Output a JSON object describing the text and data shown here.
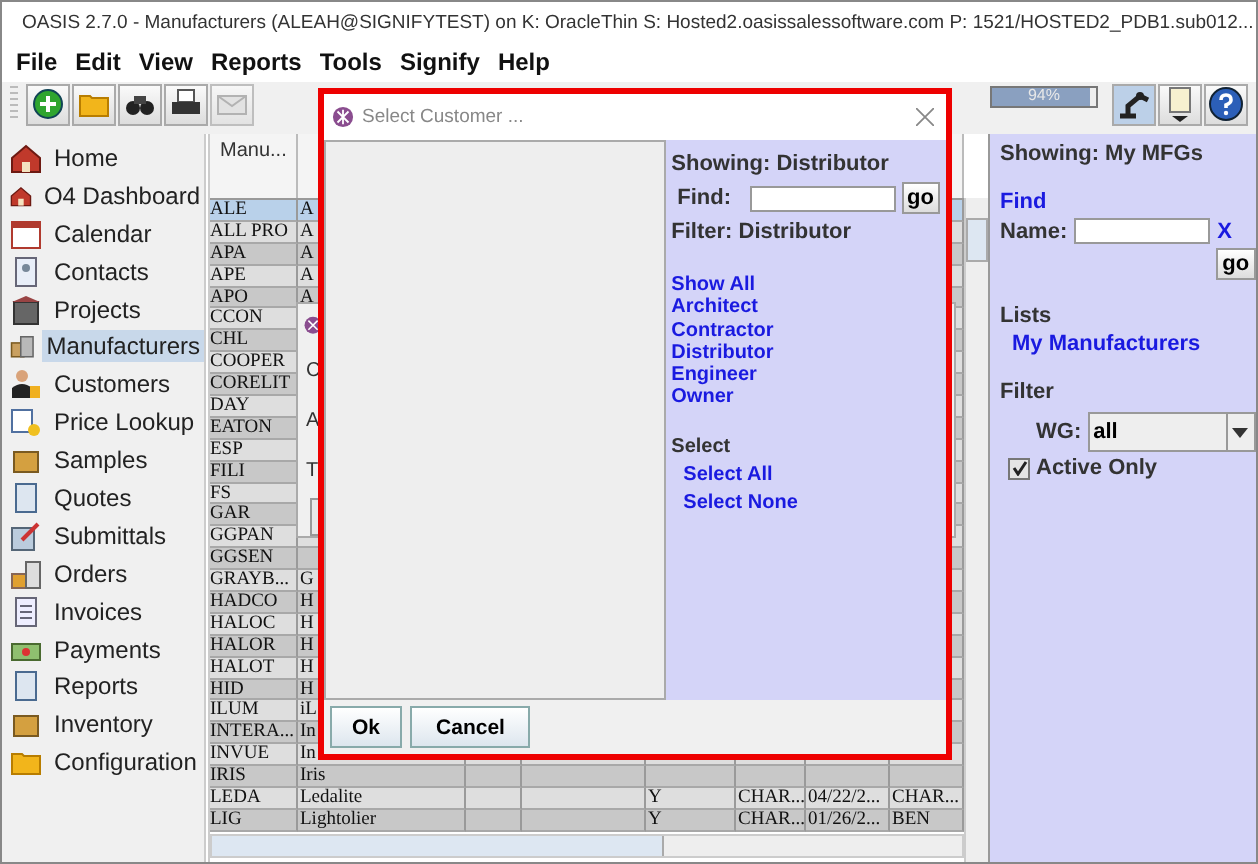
{
  "window": {
    "title": "OASIS 2.7.0 - Manufacturers (ALEAH@SIGNIFYTEST) on K: OracleThin  S: Hosted2.oasissalessoftware.com  P: 1521/HOSTED2_PDB1.sub012..."
  },
  "menu": [
    "File",
    "Edit",
    "View",
    "Reports",
    "Tools",
    "Signify",
    "Help"
  ],
  "toolbar": {
    "progress": {
      "label": "94%",
      "level": 0.94
    }
  },
  "sidebar": {
    "items": [
      {
        "label": "Home",
        "selected": false
      },
      {
        "label": "O4 Dashboard",
        "selected": false
      },
      {
        "label": "Calendar",
        "selected": false
      },
      {
        "label": "Contacts",
        "selected": false
      },
      {
        "label": "Projects",
        "selected": false
      },
      {
        "label": "Manufacturers",
        "selected": true
      },
      {
        "label": "Customers",
        "selected": false
      },
      {
        "label": "Price Lookup",
        "selected": false
      },
      {
        "label": "Samples",
        "selected": false
      },
      {
        "label": "Quotes",
        "selected": false
      },
      {
        "label": "Submittals",
        "selected": false
      },
      {
        "label": "Orders",
        "selected": false
      },
      {
        "label": "Invoices",
        "selected": false
      },
      {
        "label": "Payments",
        "selected": false
      },
      {
        "label": "Reports",
        "selected": false
      },
      {
        "label": "Inventory",
        "selected": false
      },
      {
        "label": "Configuration",
        "selected": false
      }
    ]
  },
  "table": {
    "columns": [
      "Manu..."
    ],
    "rows": [
      {
        "cells": [
          "ALE",
          "A"
        ],
        "selected": true
      },
      {
        "cells": [
          "ALL PRO",
          "A"
        ],
        "selected": false
      },
      {
        "cells": [
          "APA",
          "A"
        ],
        "selected": false
      },
      {
        "cells": [
          "APE",
          "A"
        ],
        "selected": false
      },
      {
        "cells": [
          "APO",
          "A"
        ],
        "selected": false
      },
      {
        "cells": [
          "CCON"
        ],
        "selected": false
      },
      {
        "cells": [
          "CHL"
        ],
        "selected": false
      },
      {
        "cells": [
          "COOPER"
        ],
        "selected": false
      },
      {
        "cells": [
          "CORELIT"
        ],
        "selected": false
      },
      {
        "cells": [
          "DAY"
        ],
        "selected": false
      },
      {
        "cells": [
          "EATON"
        ],
        "selected": false
      },
      {
        "cells": [
          "ESP"
        ],
        "selected": false
      },
      {
        "cells": [
          "FILI"
        ],
        "selected": false
      },
      {
        "cells": [
          "FS"
        ],
        "selected": false
      },
      {
        "cells": [
          "GAR"
        ],
        "selected": false
      },
      {
        "cells": [
          "GGPAN"
        ],
        "selected": false
      },
      {
        "cells": [
          "GGSEN"
        ],
        "selected": false
      },
      {
        "cells": [
          "GRAYB...",
          "G"
        ],
        "selected": false
      },
      {
        "cells": [
          "HADCO",
          "H"
        ],
        "selected": false
      },
      {
        "cells": [
          "HALOC",
          "H"
        ],
        "selected": false
      },
      {
        "cells": [
          "HALOR",
          "H"
        ],
        "selected": false
      },
      {
        "cells": [
          "HALOT",
          "H"
        ],
        "selected": false
      },
      {
        "cells": [
          "HID",
          "H"
        ],
        "selected": false
      },
      {
        "cells": [
          "ILUM",
          "iL"
        ],
        "selected": false
      },
      {
        "cells": [
          "INTERA...",
          "In"
        ],
        "selected": false
      },
      {
        "cells": [
          "INVUE",
          "In"
        ],
        "selected": false
      },
      {
        "cells": [
          "IRIS",
          "Iris"
        ],
        "selected": false
      },
      {
        "cells": [
          "LEDA",
          "Ledalite",
          "",
          "",
          "Y",
          "CHAR...",
          "04/22/2...",
          "CHAR..."
        ],
        "selected": false
      },
      {
        "cells": [
          "LIG",
          "Lightolier",
          "",
          "",
          "Y",
          "CHAR...",
          "01/26/2...",
          "BEN"
        ],
        "selected": false
      }
    ]
  },
  "background_dialog": {
    "labels": [
      "C",
      "A",
      "T"
    ]
  },
  "dialog": {
    "title": "Select Customer ...",
    "showing": "Showing: Distributor",
    "find_label": "Find:",
    "go": "go",
    "filter": "Filter: Distributor",
    "filter_links": [
      "Show All",
      "Architect",
      "Contractor",
      "Distributor",
      "Engineer",
      "Owner"
    ],
    "select_heading": "Select",
    "select_links": [
      "Select All",
      "Select None"
    ],
    "buttons": [
      "Ok",
      "Cancel"
    ]
  },
  "right_panel": {
    "showing": "Showing: My MFGs",
    "find_heading": "Find",
    "name_label": "Name:",
    "clear": "X",
    "go": "go",
    "lists_heading": "Lists",
    "lists": [
      "My Manufacturers"
    ],
    "filter_heading": "Filter",
    "wg_label": "WG:",
    "wg_value": "all",
    "active_only": {
      "label": "Active Only",
      "checked": true
    }
  }
}
